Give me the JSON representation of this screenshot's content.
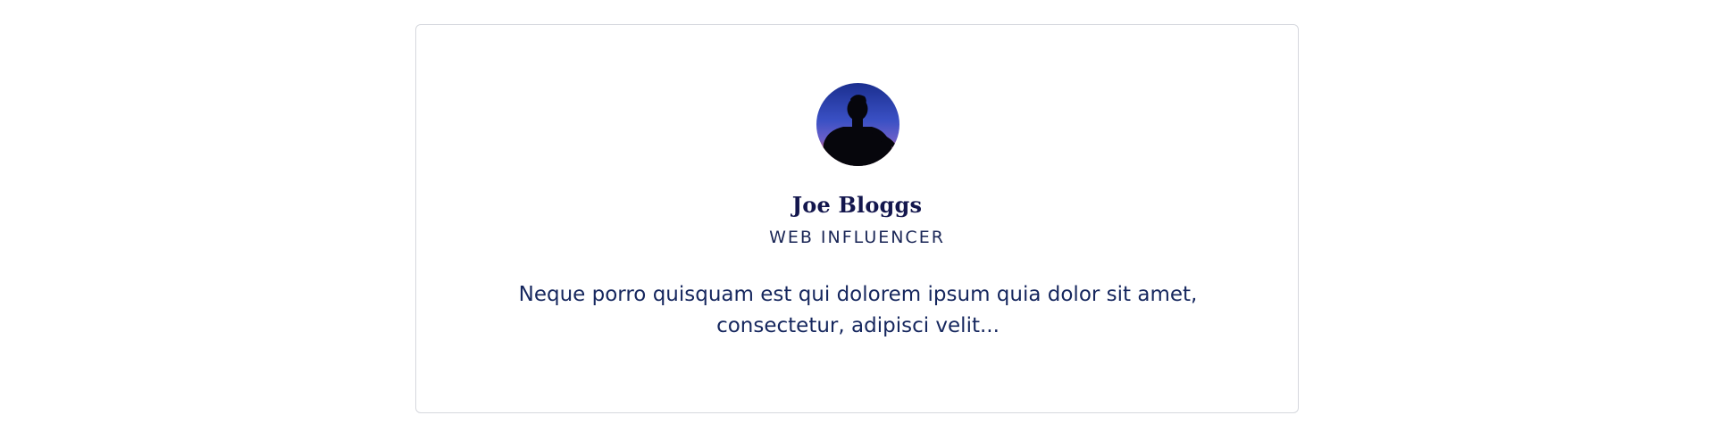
{
  "profile": {
    "name": "Joe Bloggs",
    "role": "WEB INFLUENCER",
    "quote": "Neque porro quisquam est qui dolorem ipsum quia dolor sit amet, consectetur, adipisci velit...",
    "avatar_icon": "profile-photo-silhouette"
  },
  "colors": {
    "name": "#13164d",
    "text": "#16275e",
    "border": "#d6d8de"
  }
}
